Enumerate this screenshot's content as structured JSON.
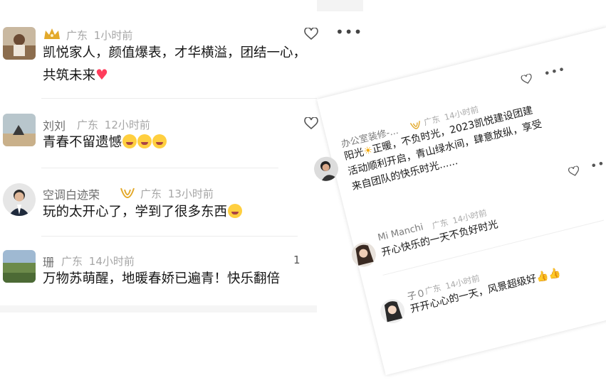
{
  "left_comments": [
    {
      "name": "",
      "location": "广东",
      "time": "1小时前",
      "text_line1": "凯悦家人，颜值爆表，才华横溢，团结一心，",
      "text_line2": "共筑未来"
    },
    {
      "name": "刘刘",
      "location": "广东",
      "time": "12小时前",
      "text_line1": "青春不留遗憾"
    },
    {
      "name": "空调白迹荣",
      "location": "广东",
      "time": "13小时前",
      "text_line1": "玩的太开心了，学到了很多东西"
    },
    {
      "name": "珊",
      "location": "广东",
      "time": "14小时前",
      "text_line1": "万物苏萌醒，地暖春娇已遍青！快乐翻倍",
      "like_count": "1"
    }
  ],
  "right_comments": [
    {
      "name": "办公室装修-...",
      "location": "广东",
      "time": "14小时前",
      "text_line1": "阳光",
      "text_line1b": "正暖，不负时光，2023凯悦建设团建",
      "text_line2": "活动顺利开启，青山绿水间，肆意放纵，享受",
      "text_line3": "来自团队的快乐时光......"
    },
    {
      "name": "Mi Manchi",
      "location": "广东",
      "time": "14小时前",
      "text_line1": "开心快乐的一天不负好时光"
    },
    {
      "name": "子０",
      "location": "广东",
      "time": "14小时前",
      "text_line1": "开开心心的一天，风景超级好"
    }
  ],
  "colors": {
    "badge_gold": "#e3a92b",
    "heart_red": "#ff3d5c",
    "text_dark": "#161616",
    "meta_grey": "#a6a6a6"
  },
  "icons": [
    "crown-icon",
    "heart-outline-icon",
    "more-dots-icon",
    "v-badge-icon",
    "sun-emoji",
    "thumbs-up-emoji",
    "grin-emoji",
    "red-heart-emoji"
  ]
}
